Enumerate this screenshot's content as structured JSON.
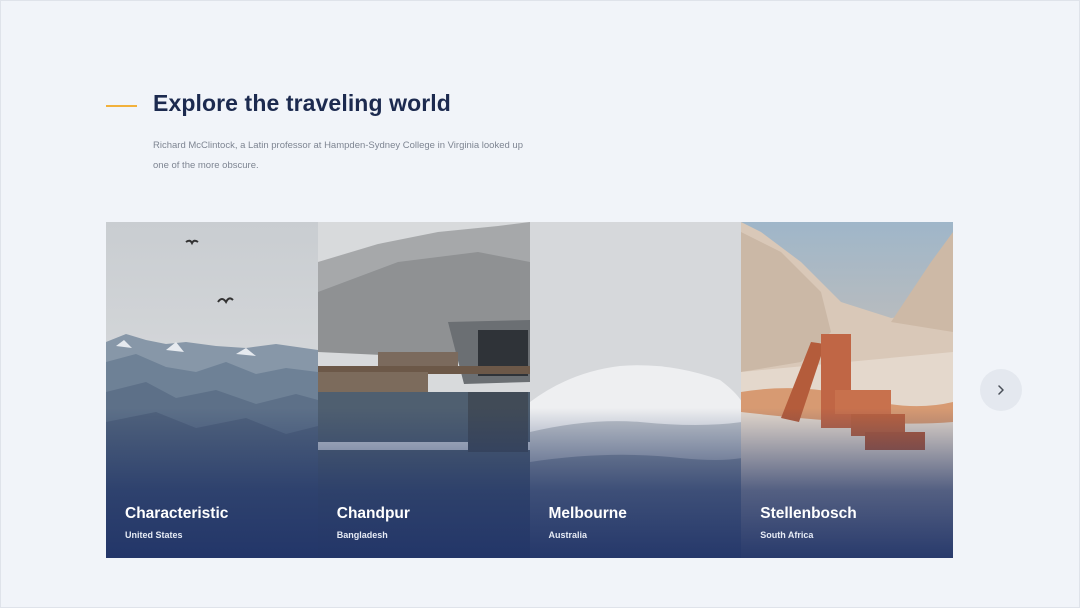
{
  "header": {
    "title": "Explore the traveling world",
    "description": "Richard McClintock, a Latin professor at Hampden-Sydney College in Virginia looked up one of the more obscure."
  },
  "destinations": [
    {
      "name": "Characteristic",
      "country": "United States"
    },
    {
      "name": "Chandpur",
      "country": "Bangladesh"
    },
    {
      "name": "Melbourne",
      "country": "Australia"
    },
    {
      "name": "Stellenbosch",
      "country": "South Africa"
    }
  ],
  "carousel": {
    "next_icon": "chevron-right-icon"
  },
  "colors": {
    "background": "#f1f4f9",
    "title": "#1c2a4f",
    "accent": "#f2b13c",
    "card_overlay": "#213468"
  }
}
